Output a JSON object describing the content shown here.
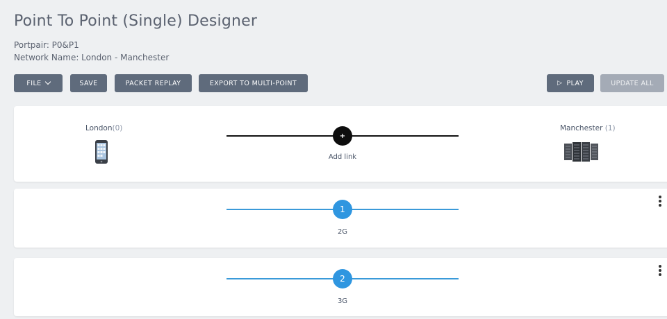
{
  "header": {
    "title": "Point To Point (Single) Designer",
    "portpair": "Portpair: P0&P1",
    "network": "Network Name: London - Manchester"
  },
  "toolbar": {
    "file_label": "FILE",
    "save_label": "SAVE",
    "packet_replay_label": "PACKET REPLAY",
    "export_label": "EXPORT TO MULTI-POINT",
    "play_label": "PLAY",
    "update_all_label": "UPDATE ALL"
  },
  "endpoints": {
    "left": {
      "name": "London",
      "count": "(0)",
      "icon": "mobile-phone-icon"
    },
    "right": {
      "name": "Manchester",
      "count": "(1)",
      "icon": "server-rack-icon"
    }
  },
  "add_link": {
    "symbol": "+",
    "label": "Add link"
  },
  "links": [
    {
      "number": "1",
      "label": "2G"
    },
    {
      "number": "2",
      "label": "3G"
    }
  ],
  "colors": {
    "button": "#5f6b7c",
    "button_disabled": "#a4abb6",
    "link_blue": "#2f96e0",
    "background": "#eef0f2"
  }
}
